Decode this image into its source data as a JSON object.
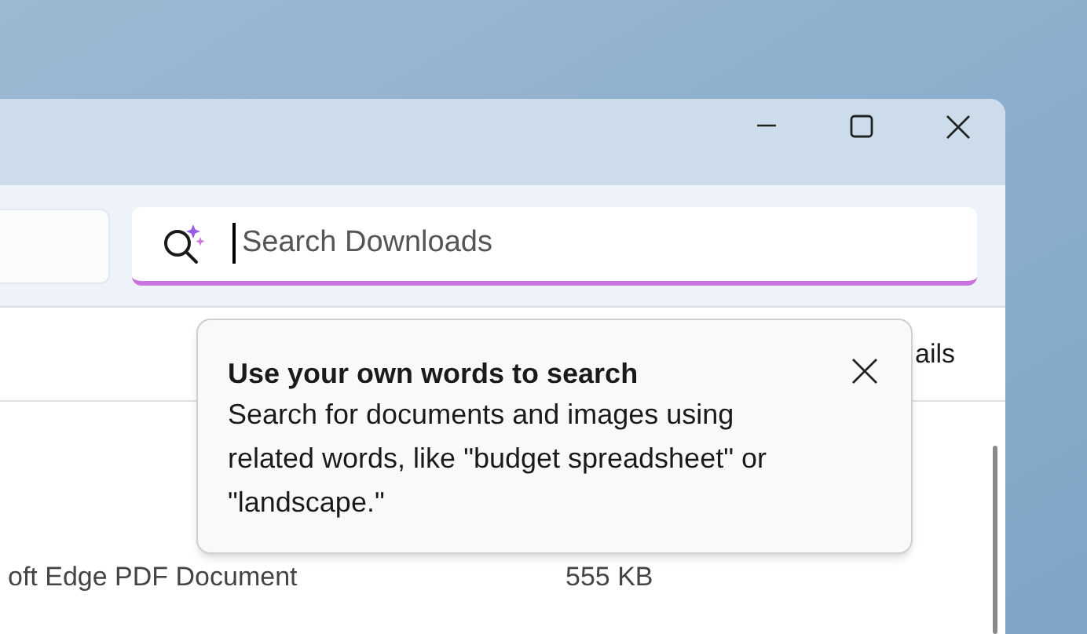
{
  "search": {
    "placeholder": "Search Downloads",
    "focused": true
  },
  "command_bar": {
    "button_label": "ails"
  },
  "file_rows": [
    {
      "type": "oft Edge PDF Document",
      "size": "555 KB"
    }
  ],
  "teaching_tip": {
    "title": "Use your own words to search",
    "body": "Search for documents and images using related words, like \"budget spreadsheet\" or \"landscape.\""
  }
}
